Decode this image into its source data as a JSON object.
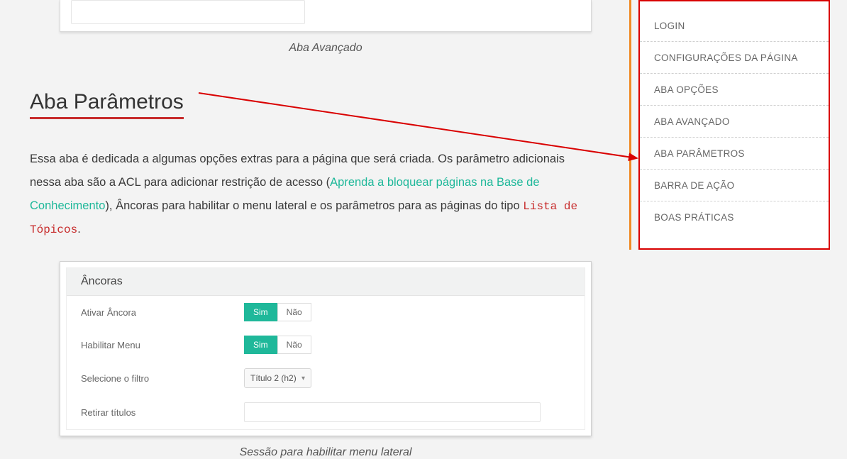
{
  "caption_top": "Aba Avançado",
  "section_title": "Aba Parâmetros",
  "paragraph": {
    "p1": "Essa aba é dedicada a algumas opções extras para a página que será criada. Os parâmetro adicionais nessa aba são a ACL para adicionar restrição de acesso (",
    "link": "Aprenda a bloquear páginas na Base de Conhecimento",
    "p2": "), Âncoras para habilitar o menu lateral e os parâmetros para as páginas do tipo ",
    "code": "Lista de Tópicos",
    "p3": "."
  },
  "anchor_card": {
    "title": "Âncoras",
    "fields": {
      "ativar": "Ativar Âncora",
      "habilitar": "Habilitar Menu",
      "selecione": "Selecione o filtro",
      "retirar": "Retirar títulos"
    },
    "toggle": {
      "sim": "Sim",
      "nao": "Não"
    },
    "select_value": "Título 2 (h2)"
  },
  "caption_anchor": "Sessão para habilitar menu lateral",
  "sidebar": [
    "LOGIN",
    "CONFIGURAÇÕES DA PÁGINA",
    "ABA OPÇÕES",
    "ABA AVANÇADO",
    "ABA PARÂMETROS",
    "BARRA DE AÇÃO",
    "BOAS PRÁTICAS"
  ]
}
